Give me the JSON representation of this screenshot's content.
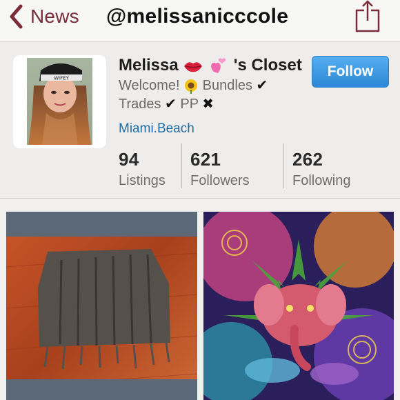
{
  "nav": {
    "back_label": "News",
    "title": "@melissanicccole"
  },
  "profile": {
    "name_prefix": "Melissa",
    "name_suffix": "'s Closet",
    "bio": {
      "line1": "Welcome!",
      "bundles": "Bundles",
      "trades": "Trades",
      "pp": "PP",
      "check_mark": "✔",
      "x_mark": "✖"
    },
    "location": "Miami.Beach",
    "follow_label": "Follow",
    "stats": [
      {
        "value": "94",
        "label": "Listings"
      },
      {
        "value": "621",
        "label": "Followers"
      },
      {
        "value": "262",
        "label": "Following"
      }
    ]
  },
  "icons": {
    "back": "chevron-left-icon",
    "share": "share-icon",
    "lips": "lips-emoji",
    "hearts": "sparkling-heart-emoji",
    "sunflower": "sunflower-emoji"
  },
  "colors": {
    "accent": "#7a2c3a",
    "link": "#1f6ea3",
    "follow_button": "#2c88d6"
  }
}
